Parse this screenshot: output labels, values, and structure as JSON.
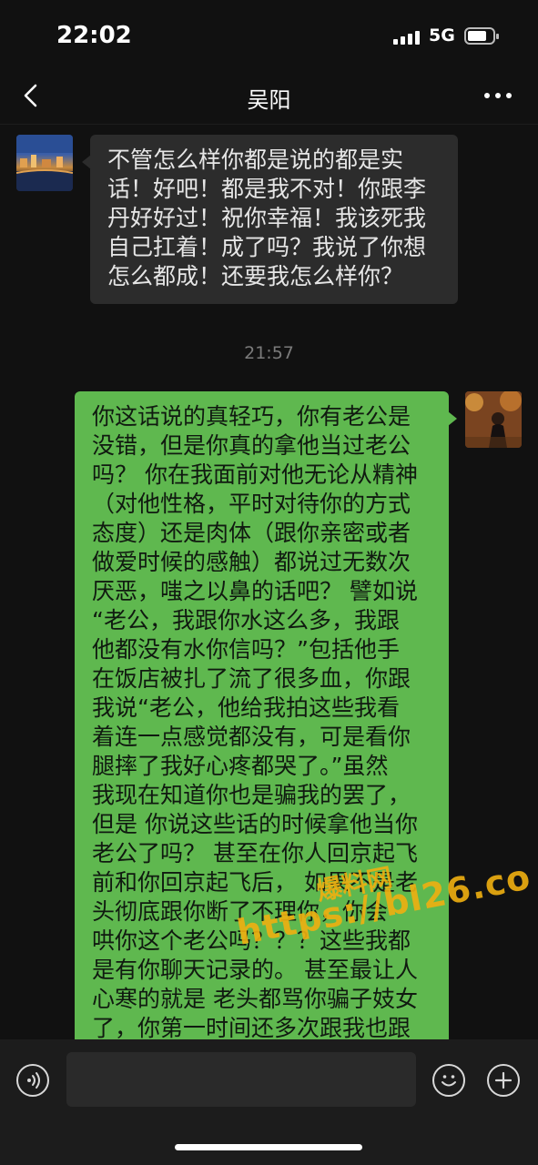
{
  "status_bar": {
    "time": "22:02",
    "network": "5G"
  },
  "header": {
    "title": "吴阳",
    "back_icon": "chevron-left-icon",
    "more_icon": "ellipsis-icon"
  },
  "messages": [
    {
      "side": "incoming",
      "text": "不管怎么样你都是说的都是实\n话！好吧！都是我不对！你跟李\n丹好好过！祝你幸福！我该死我\n自己扛着！成了吗？我说了你想\n怎么都成！还要我怎么样你？"
    },
    {
      "side": "timestamp",
      "text": "21:57"
    },
    {
      "side": "outgoing",
      "text": "你这话说的真轻巧，你有老公是\n没错，但是你真的拿他当过老公\n吗？ 你在我面前对他无论从精神\n（对他性格，平时对待你的方式\n态度）还是肉体（跟你亲密或者\n做爱时候的感触）都说过无数次\n厌恶，嗤之以鼻的话吧？ 譬如说\n“老公，我跟你水这么多，我跟\n他都没有水你信吗？”包括他手\n在饭店被扎了流了很多血，你跟\n我说“老公，他给我拍这些我看\n着连一点感觉都没有，可是看你\n腿摔了我好心疼都哭了。”虽然\n我现在知道你也是骗我的罢了，\n但是 你说这些话的时候拿他当你\n老公了吗？ 甚至在你人回京起飞\n前和你回京起飞后， 如果不是老\n头彻底跟你断了不理你，你会\n哄你这个老公吗？？？这些我都\n是有你聊天记录的。 甚至最让人\n心寒的就是 老头都骂你骗子妓女\n了，你第一时间还多次跟我也跟"
    }
  ],
  "watermark": {
    "line1": "爆料网",
    "line2": "https://bl26.co"
  },
  "input_bar": {
    "voice_icon": "voice-icon",
    "emoji_icon": "emoji-icon",
    "plus_icon": "plus-icon"
  },
  "colors": {
    "background": "#111111",
    "incoming_bubble": "#2c2c2c",
    "outgoing_bubble": "#5fb84f",
    "watermark": "#f0b010"
  }
}
